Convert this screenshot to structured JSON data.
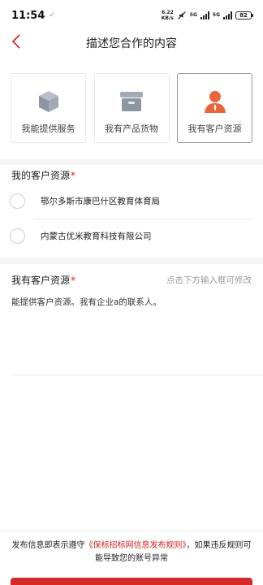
{
  "status_bar": {
    "time": "11:54",
    "extra_icon": "wechat-notify-icon",
    "net_speed_value": "6.22",
    "net_speed_unit": "KB/s",
    "sim1_label": "5G",
    "sim2_label": "5G",
    "battery": "82"
  },
  "nav": {
    "title": "描述您合作的内容",
    "back_icon": "chevron-left-icon",
    "accent_color": "#d42020"
  },
  "cards": [
    {
      "label": "我能提供服务",
      "icon": "box-icon",
      "selected": false
    },
    {
      "label": "我有产品货物",
      "icon": "storage-box-icon",
      "selected": false
    },
    {
      "label": "我有客户资源",
      "icon": "person-icon",
      "selected": true
    }
  ],
  "resources": {
    "label": "我的客户资源",
    "required_mark": "*",
    "options": [
      {
        "text": "鄂尔多斯市康巴什区教育体育局",
        "checked": false
      },
      {
        "text": "内蒙古优米教育科技有限公司",
        "checked": false
      }
    ]
  },
  "description": {
    "label": "我有客户资源",
    "required_mark": "*",
    "hint": "点击下方输入框可修改",
    "value": "能提供客户资源。我有企业a的联系人。"
  },
  "footer": {
    "notice_prefix": "发布信息即表示遵守",
    "rules_link": "《保标招标网信息发布规则》",
    "notice_suffix": "，如果违反规则可能导致您的账号异常"
  }
}
